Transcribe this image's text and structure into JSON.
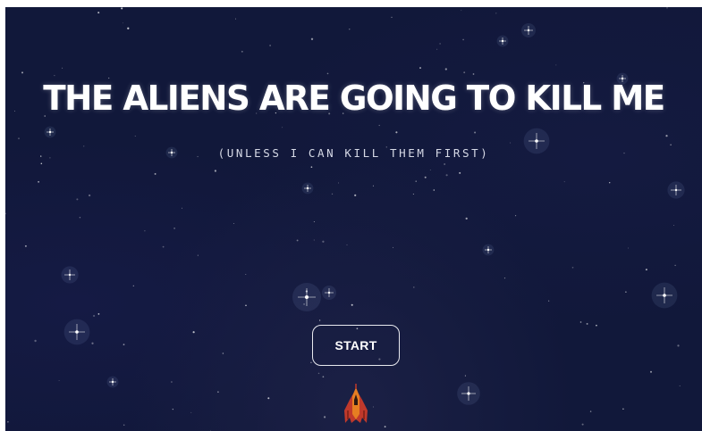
{
  "game": {
    "title": "THE ALIENS ARE GOING TO KILL ME",
    "subtitle": "(UNLESS I CAN KILL THEM FIRST)",
    "start_label": "START",
    "player_ship": "player-spaceship-icon"
  },
  "colors": {
    "background": "#11183a",
    "title_text": "#ffffff",
    "subtitle_text": "#d6d9e6",
    "button_border": "#e8e9ef",
    "ship_primary": "#c0392b",
    "ship_accent": "#e67e22"
  }
}
